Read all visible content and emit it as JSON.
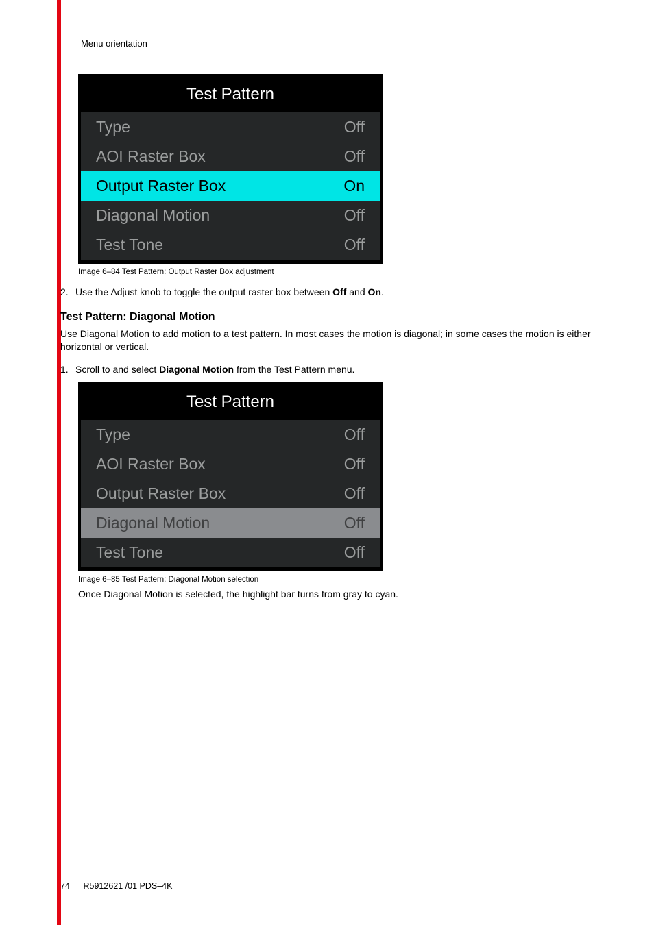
{
  "header": "Menu orientation",
  "panel1": {
    "title": "Test Pattern",
    "rows": [
      {
        "label": "Type",
        "value": "Off"
      },
      {
        "label": "AOI Raster Box",
        "value": "Off"
      },
      {
        "label": "Output Raster Box",
        "value": "On"
      },
      {
        "label": "Diagonal Motion",
        "value": "Off"
      },
      {
        "label": "Test Tone",
        "value": "Off"
      }
    ],
    "caption": "Image 6–84  Test Pattern: Output Raster Box adjustment"
  },
  "step2": {
    "num": "2.",
    "pre": "Use the Adjust knob to toggle the output raster box between ",
    "b1": "Off",
    "mid": " and ",
    "b2": "On",
    "post": "."
  },
  "heading1": "Test Pattern: Diagonal Motion",
  "para1": "Use Diagonal Motion to add motion to a test pattern. In most cases the motion is diagonal; in some cases the motion is either horizontal or vertical.",
  "step1b": {
    "num": "1.",
    "pre": "Scroll to and select ",
    "b1": "Diagonal Motion",
    "post": " from the Test Pattern menu."
  },
  "panel2": {
    "title": "Test Pattern",
    "rows": [
      {
        "label": "Type",
        "value": "Off"
      },
      {
        "label": "AOI Raster Box",
        "value": "Off"
      },
      {
        "label": "Output Raster Box",
        "value": "Off"
      },
      {
        "label": "Diagonal Motion",
        "value": "Off"
      },
      {
        "label": "Test Tone",
        "value": "Off"
      }
    ],
    "caption": "Image 6–85  Test Pattern: Diagonal Motion selection"
  },
  "para2": "Once Diagonal Motion is selected, the highlight bar turns from gray to cyan.",
  "footer": {
    "page": "74",
    "doc": "R5912621 /01 PDS–4K"
  }
}
